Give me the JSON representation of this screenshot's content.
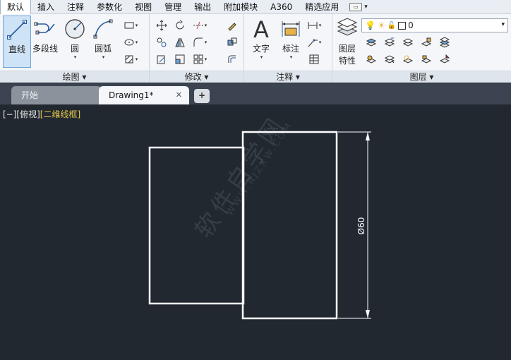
{
  "menu": {
    "tabs": [
      "默认",
      "插入",
      "注释",
      "参数化",
      "视图",
      "管理",
      "输出",
      "附加模块",
      "A360",
      "精选应用"
    ],
    "active_index": 0
  },
  "ribbon": {
    "draw": {
      "title": "绘图 ▾",
      "line_label": "直线",
      "polyline_label": "多段线",
      "circle_label": "圆",
      "arc_label": "圆弧"
    },
    "modify": {
      "title": "修改 ▾"
    },
    "annotation": {
      "title": "注释 ▾",
      "text_label": "文字",
      "dimension_label": "标注"
    },
    "layers": {
      "title": "图层 ▾",
      "properties_label_1": "图层",
      "properties_label_2": "特性",
      "current_layer": "0"
    }
  },
  "file_tabs": {
    "start_label": "开始",
    "drawing_label": "Drawing1*",
    "close_symbol": "✕",
    "new_symbol": "+"
  },
  "viewport": {
    "label_prefix": "[−][俯视]",
    "label_style": "[二维线框]"
  },
  "drawing": {
    "dimension_text": "Ø60"
  },
  "watermark": {
    "main": "软件自学网",
    "sub": "WWW.RJZXW.COM"
  },
  "colors": {
    "canvas_bg": "#212830",
    "ribbon_bg": "#f4f6f9",
    "accent": "#6ba2d6",
    "viewport_style": "#e6c94a"
  }
}
